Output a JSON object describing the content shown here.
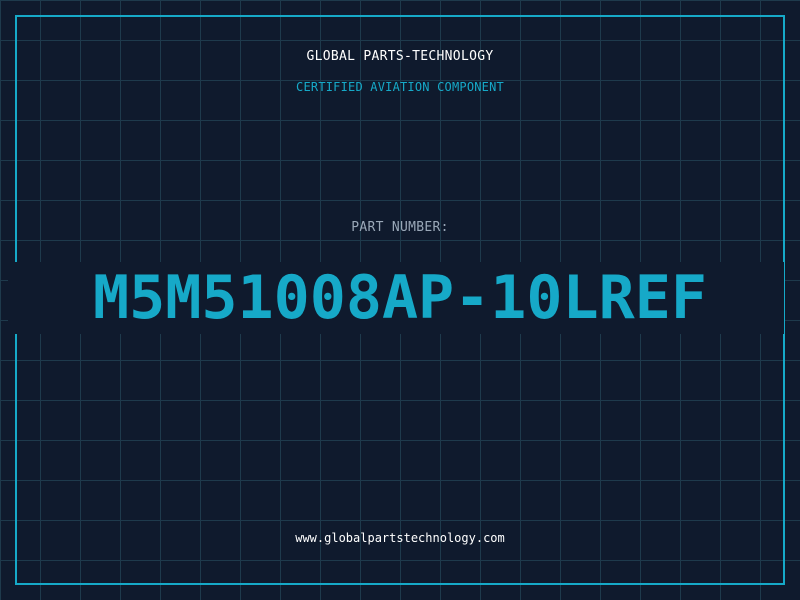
{
  "header": {
    "company": "GLOBAL PARTS-TECHNOLOGY",
    "tagline": "CERTIFIED AVIATION COMPONENT"
  },
  "part": {
    "label": "PART NUMBER:",
    "number": "M5M51008AP-10LREF"
  },
  "footer": {
    "website": "www.globalpartstechnology.com"
  },
  "colors": {
    "background": "#0f1a2d",
    "grid": "#1e3a4c",
    "accent": "#16a9c8",
    "label": "#9aa8b8",
    "text": "#ffffff"
  }
}
